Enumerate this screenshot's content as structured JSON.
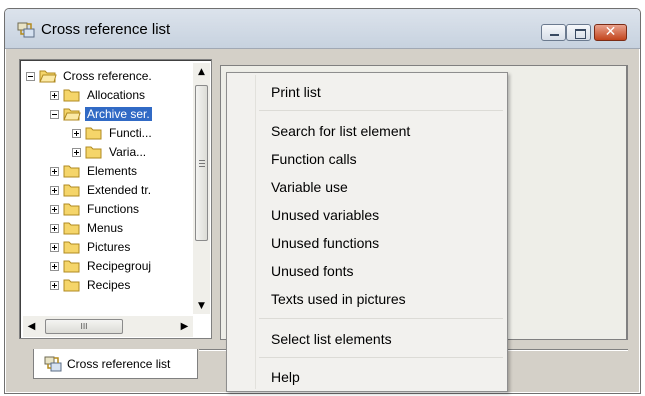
{
  "window": {
    "title": "Cross reference list",
    "controls": {
      "close_glyph": "✕"
    }
  },
  "tree": {
    "root": "Cross reference.",
    "items": [
      {
        "label": "Allocations"
      },
      {
        "label": "Archive ser."
      },
      {
        "label": "Functi..."
      },
      {
        "label": "Varia..."
      },
      {
        "label": "Elements"
      },
      {
        "label": "Extended tr."
      },
      {
        "label": "Functions"
      },
      {
        "label": "Menus"
      },
      {
        "label": "Pictures"
      },
      {
        "label": "Recipegrouj"
      },
      {
        "label": "Recipes"
      }
    ],
    "hscroll_grip": "III"
  },
  "tabs": [
    {
      "label": "Cross reference list"
    }
  ],
  "context_menu": {
    "items": [
      {
        "label": "Print list"
      },
      {
        "label": "Search for list element"
      },
      {
        "label": "Function calls"
      },
      {
        "label": "Variable use"
      },
      {
        "label": "Unused variables"
      },
      {
        "label": "Unused functions"
      },
      {
        "label": "Unused fonts"
      },
      {
        "label": "Texts used in pictures"
      },
      {
        "label": "Select list elements"
      },
      {
        "label": "Help"
      }
    ]
  },
  "icons": {
    "app": "cross-reference-icon",
    "folder": "folder-icon"
  },
  "colors": {
    "selection": "#316ac5",
    "folder": "#f5d56a",
    "close_button": "#c2441c"
  }
}
